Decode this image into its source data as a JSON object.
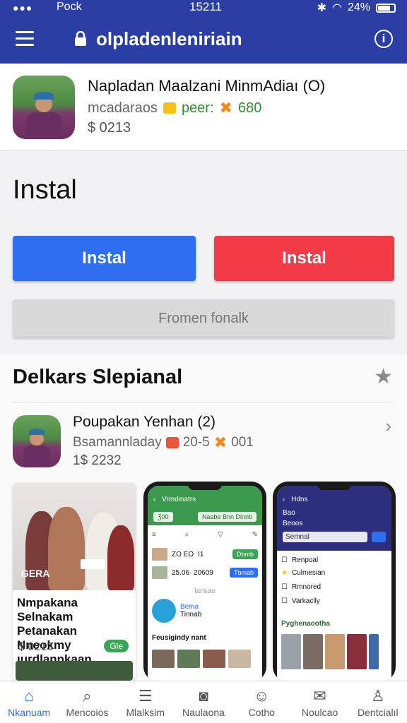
{
  "status": {
    "carrier": "Pock",
    "time": "15211",
    "battery": "24%"
  },
  "appbar": {
    "url": "olpladenleniriain"
  },
  "profile": {
    "name": "Napladan Maalzani MinmAdiaı (O)",
    "meta_text": "mcadaraos",
    "meta_green": "peer:",
    "rating": "680",
    "price": "$  0213"
  },
  "install": {
    "title": "Instal",
    "blue_label": "Instal",
    "red_label": "Instal",
    "grey_label": "Fromen fonalk"
  },
  "section": {
    "title": "Delkars Slepianal",
    "item": {
      "name": "Poupakan Yenhan (2)",
      "meta_text": "Bsamannladay",
      "meta_num": "20-5",
      "rating": "001",
      "price": "1$  2232"
    },
    "card": {
      "photo_label": "GERA",
      "title": "Nmpakana Selnakam Petanakan Nneokmy ıurdlannkaan",
      "price": "$ 0213",
      "badge": "Gle"
    },
    "phone2": {
      "header": "Vrmdinatrs",
      "tab": "Ʒ00",
      "tab2": "Naabe Bnn Dinnb",
      "row1_a": "ZO EO",
      "row1_b": "I1",
      "row1_c": "Dbmb",
      "row2_a": "25.06",
      "row2_b": "20609",
      "row2_c": "Tbmab",
      "sub_hint": "lansao",
      "app_name": "Bema",
      "app_sub": "Tinnab",
      "footer": "Feusigindy nant"
    },
    "phone3": {
      "header": "Hdns",
      "sub1": "Bao",
      "sub2": "Beoos",
      "search": "Semnal",
      "list": [
        "Renpoal",
        "Culmesian",
        "Rmnored",
        "Varkaclly"
      ],
      "footer": "Pyghenaootha"
    }
  },
  "bottomnav": {
    "tabs": [
      "Nkanuam",
      "Mencoios",
      "Mlalksim",
      "Naulaona",
      "Cotho",
      "Noulcao",
      "Dentcialıl"
    ],
    "active_index": 0
  },
  "colors": {
    "primary": "#2b3ea3",
    "blue_button": "#2d6ff0",
    "red_button": "#f23b46",
    "green": "#3aa556"
  }
}
